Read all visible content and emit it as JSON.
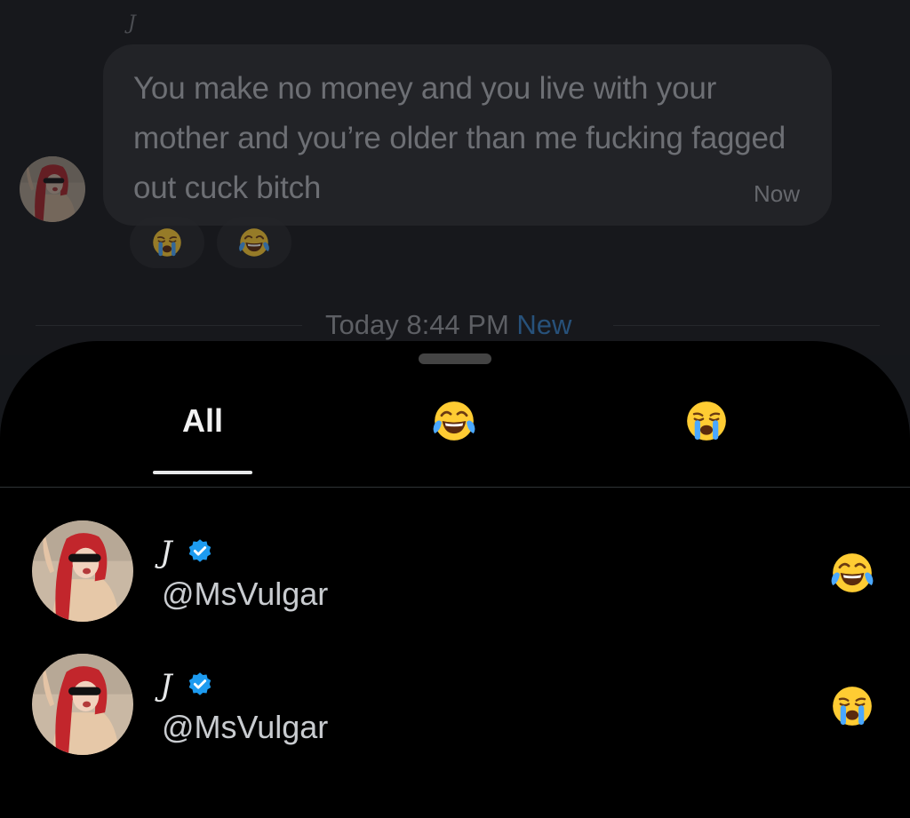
{
  "chat": {
    "sender_name": "J",
    "message": "You make no money and you live with your mother and you’re older than me fucking fagged out cuck bitch",
    "time": "Now",
    "reactions": [
      "loudly-crying-face",
      "face-with-tears-of-joy"
    ],
    "divider_time": "Today 8:44 PM",
    "divider_new": "New"
  },
  "sheet": {
    "tabs": [
      {
        "label": "All",
        "active": true
      },
      {
        "icon": "face-with-tears-of-joy"
      },
      {
        "icon": "loudly-crying-face"
      }
    ],
    "reactors": [
      {
        "name": "J",
        "verified": true,
        "handle": "@MsVulgar",
        "reaction": "face-with-tears-of-joy"
      },
      {
        "name": "J",
        "verified": true,
        "handle": "@MsVulgar",
        "reaction": "loudly-crying-face"
      }
    ]
  },
  "colors": {
    "verified_blue": "#1d9bf0",
    "new_blue": "#27517a"
  }
}
